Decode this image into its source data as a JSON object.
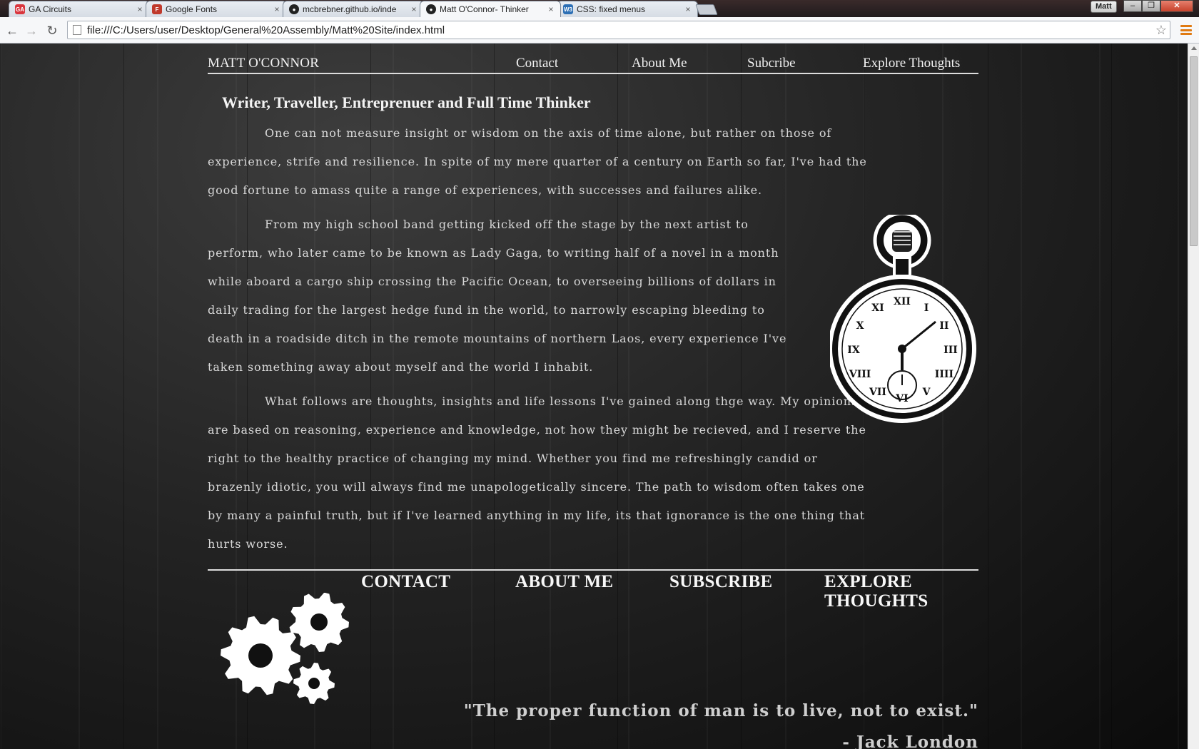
{
  "browser": {
    "tabs": [
      {
        "label": "GA Circuits",
        "icon": "ga-favicon",
        "color": "#d9363e",
        "glyph": "GA"
      },
      {
        "label": "Google Fonts",
        "icon": "google-fonts-favicon",
        "color": "#c0392b",
        "glyph": "F"
      },
      {
        "label": "mcbrebner.github.io/inde",
        "icon": "github-favicon",
        "color": "#222222",
        "glyph": "●"
      },
      {
        "label": "Matt O'Connor- Thinker",
        "icon": "github-favicon",
        "color": "#222222",
        "glyph": "●",
        "active": true
      },
      {
        "label": "CSS: fixed menus",
        "icon": "w3schools-favicon",
        "color": "#2c6fb5",
        "glyph": "W3"
      }
    ],
    "tab_close_glyph": "×",
    "profile_name": "Matt",
    "window_buttons": {
      "minimize": "–",
      "maximize": "❐",
      "close": "✕"
    },
    "nav": {
      "back": "←",
      "forward": "→",
      "reload": "↻"
    },
    "url": "file:///C:/Users/user/Desktop/General%20Assembly/Matt%20Site/index.html",
    "bookmark_star": "☆"
  },
  "site": {
    "brand": "MATT O'CONNOR",
    "nav": {
      "contact": "Contact",
      "about": "About Me",
      "subscribe": "Subcribe",
      "explore": "Explore Thoughts"
    },
    "tagline": "Writer, Traveller, Entreprenuer and Full Time Thinker",
    "paragraphs": [
      "One can not measure insight or wisdom on the axis of time alone, but rather on those of experience, strife and resilience. In spite of my mere quarter of a century on Earth so far, I've had the good fortune to amass quite a range of experiences, with successes and failures alike.",
      "From my high school band getting kicked off the stage by the next artist to perform, who later came to be known as Lady Gaga, to writing half of a novel in a month while aboard a cargo ship crossing the Pacific Ocean, to overseeing billions of dollars in daily trading for the largest hedge fund in the world, to narrowly escaping bleeding to death in a roadside ditch in the remote mountains of northern Laos, every experience I've taken something away about myself and the world I inhabit.",
      "What follows are thoughts, insights and life lessons I've gained along thge way. My opinions are based on reasoning, experience and knowledge, not how they might be recieved, and I reserve the right to the healthy practice of changing my mind. Whether you find me refreshingly candid or brazenly idiotic, you will always find me unapologetically sincere. The path to wisdom often takes one by many a painful truth, but if I've learned anything in my life, its that ignorance is the one thing that hurts worse."
    ],
    "footer_nav": {
      "contact": "CONTACT",
      "about": "ABOUT ME",
      "subscribe": "SUBSCRIBE",
      "explore_line1": "EXPLORE",
      "explore_line2": "THOUGHTS"
    },
    "quote": "\"The proper function of man is to live, not to exist.\"",
    "quote_author": "- Jack London",
    "images": {
      "watch": "pocket-watch-icon",
      "gears": "gears-icon"
    }
  }
}
